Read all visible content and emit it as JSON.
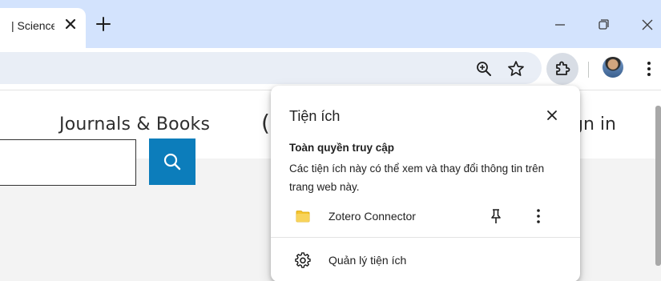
{
  "tab": {
    "title": "| Science",
    "close_label": "✕"
  },
  "new_tab_label": "+",
  "window_controls": {
    "minimize_icon": "minimize-icon",
    "maximize_icon": "restore-icon",
    "close_icon": "close-icon"
  },
  "toolbar": {
    "icons": [
      "zoom-icon",
      "bookmark-star-icon",
      "extensions-puzzle-icon",
      "profile-avatar",
      "more-menu-icon"
    ]
  },
  "page": {
    "nav_journals": "Journals & Books",
    "nav_paren": "(",
    "nav_signin": "gn in",
    "search_button_icon": "search-icon",
    "colors": {
      "search_button": "#0c7dbb",
      "band": "#f3f3f3"
    }
  },
  "popup": {
    "title": "Tiện ích",
    "section_heading": "Toàn quyền truy cập",
    "section_desc": "Các tiện ích này có thể xem và thay đổi thông tin trên trang web này.",
    "extension_name": "Zotero Connector",
    "manage_label": "Quản lý tiện ích"
  },
  "colors": {
    "tabstrip": "#d3e3fd",
    "omnibox": "#e9eef6",
    "ext_button_active": "#d8dde5"
  }
}
